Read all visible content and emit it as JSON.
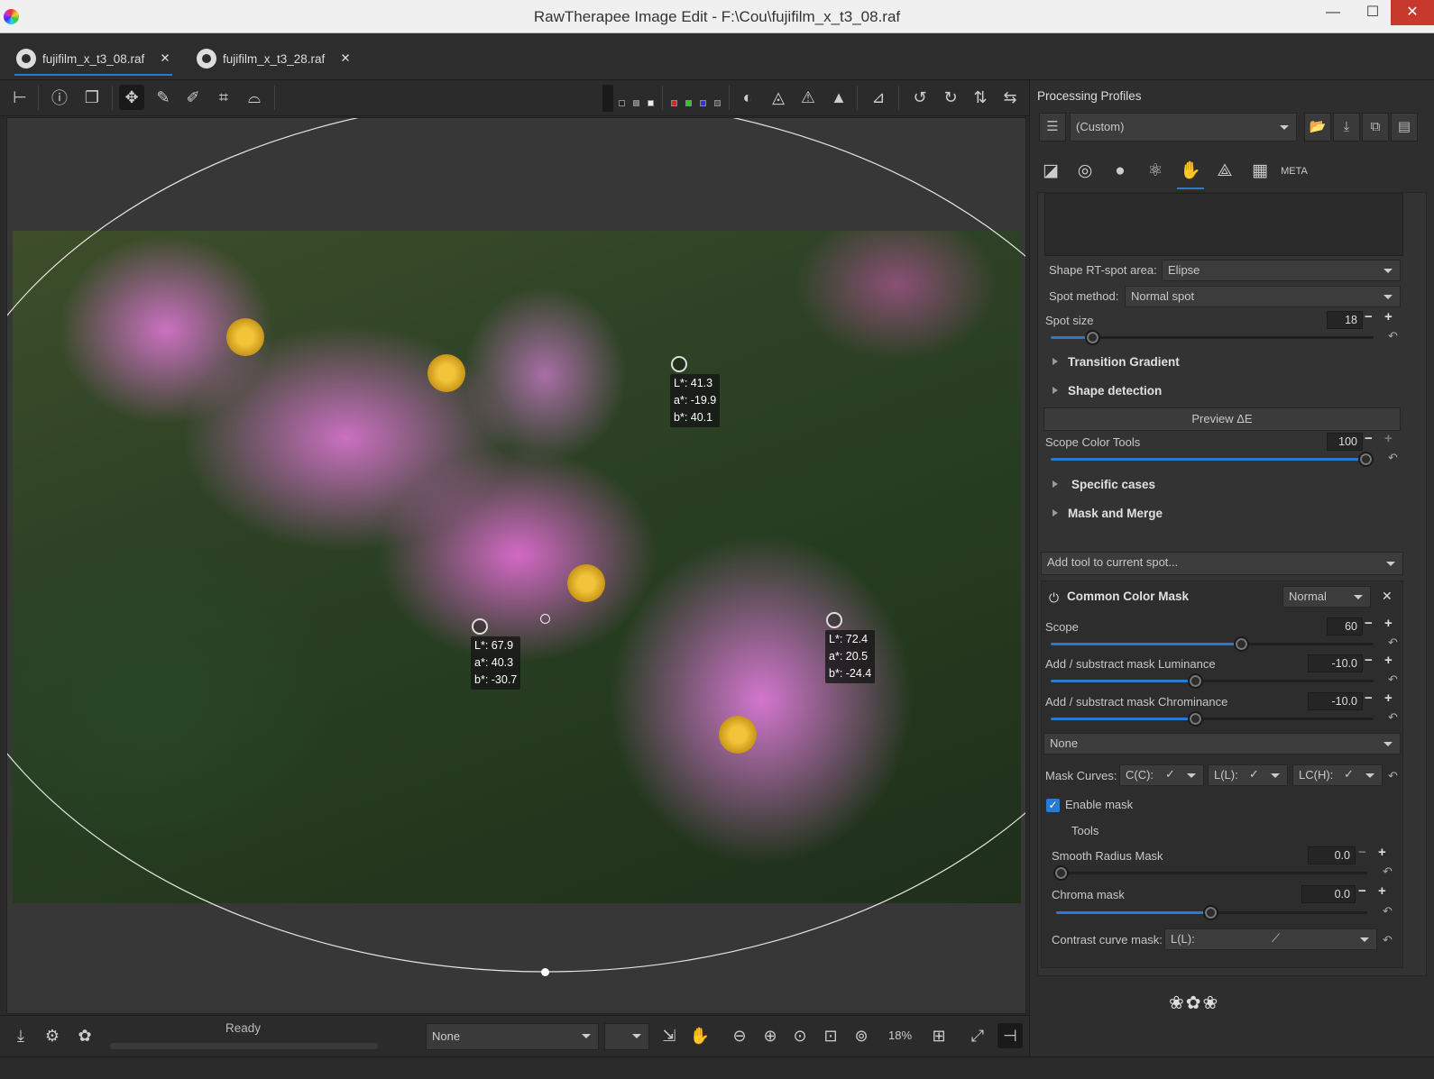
{
  "window": {
    "title": "RawTherapee Image Edit - F:\\Cou\\fujifilm_x_t3_08.raf",
    "minimize": "—",
    "maximize": "☐",
    "close": "✕"
  },
  "tabs": [
    {
      "label": "fujifilm_x_t3_08.raf",
      "close": "✕",
      "active": true
    },
    {
      "label": "fujifilm_x_t3_28.raf",
      "close": "✕",
      "active": false
    }
  ],
  "toolbar": {
    "icons": [
      "hide-panel-icon",
      "info-icon",
      "before-after-icon",
      "hand-tool-icon",
      "white-balance-picker-icon",
      "color-picker-icon",
      "crop-icon",
      "straighten-icon",
      "focus-mask-icon",
      "shadow-clip-icon",
      "highlight-clip-icon",
      "warning-icon",
      "warning-filled-icon",
      "histogram-icon",
      "rotate-left-icon",
      "rotate-right-icon",
      "flip-vertical-icon",
      "flip-horizontal-icon"
    ]
  },
  "samples": [
    {
      "L": "L*: 41.3",
      "a": "a*: -19.9",
      "b": "b*: 40.1"
    },
    {
      "L": "L*: 67.9",
      "a": "a*: 40.3",
      "b": "b*: -30.7"
    },
    {
      "L": "L*: 72.4",
      "a": "a*: 20.5",
      "b": "b*: -24.4"
    }
  ],
  "bottom": {
    "status": "Ready",
    "profile_select": "None",
    "zoom": "18%"
  },
  "right_panel": {
    "processing_profiles_label": "Processing Profiles",
    "profile_value": "(Custom)",
    "shape_label": "Shape RT-spot area:",
    "shape_value": "Elipse",
    "spot_method_label": "Spot method:",
    "spot_method_value": "Normal spot",
    "spot_size_label": "Spot size",
    "spot_size_value": "18",
    "spot_size_fraction": 0.12,
    "transition_gradient": "Transition Gradient",
    "shape_detection": "Shape detection",
    "preview_delta_e": "Preview ΔE",
    "scope_color_tools_label": "Scope Color Tools",
    "scope_color_tools_value": "100",
    "scope_color_tools_fraction": 1.0,
    "specific_cases": "Specific cases",
    "mask_and_merge": "Mask and Merge",
    "add_tool_placeholder": "Add tool to current spot...",
    "common_color_mask": "Common Color Mask",
    "ccm_mode": "Normal",
    "scope_label": "Scope",
    "scope_value": "60",
    "scope_fraction": 0.6,
    "lum_label": "Add / substract mask Luminance",
    "lum_value": "-10.0",
    "lum_fraction": 0.45,
    "chroma_label": "Add / substract mask Chrominance",
    "chroma_value": "-10.0",
    "chroma_fraction": 0.45,
    "none_select": "None",
    "mask_curves_label": "Mask Curves:",
    "curve_cc": "C(C):",
    "curve_ll": "L(L):",
    "curve_lch": "LC(H):",
    "enable_mask": "Enable mask",
    "tools_label": "Tools",
    "smooth_radius_label": "Smooth Radius Mask",
    "smooth_radius_value": "0.0",
    "smooth_radius_fraction": 0.0,
    "chroma_mask_label": "Chroma mask",
    "chroma_mask_value": "0.0",
    "chroma_mask_fraction": 0.5,
    "contrast_curve_label": "Contrast curve mask:",
    "contrast_curve_value": "L(L):"
  },
  "colors": {
    "accent": "#2a7bd0",
    "close_red": "#c7392d"
  }
}
